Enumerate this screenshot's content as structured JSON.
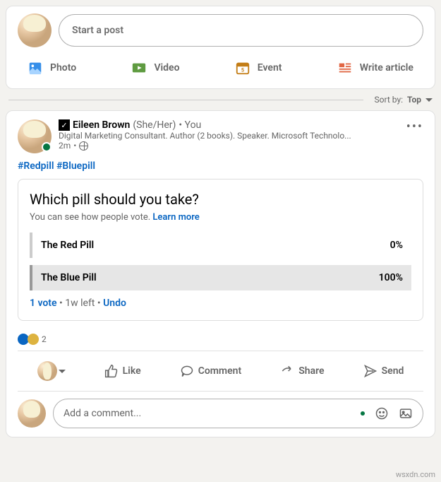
{
  "start_post": {
    "placeholder": "Start a post",
    "photo": "Photo",
    "video": "Video",
    "event": "Event",
    "article": "Write article"
  },
  "sort": {
    "label": "Sort by:",
    "value": "Top"
  },
  "post": {
    "name": "Eileen Brown",
    "pronoun": "(She/Her)",
    "you": "• You",
    "headline": "Digital Marketing Consultant. Author (2 books). Speaker. Microsoft Technolo...",
    "time": "2m",
    "hashtags": [
      "#Redpill",
      "#Bluepill"
    ]
  },
  "poll": {
    "question": "Which pill should you take?",
    "subtext": "You can see how people vote.",
    "learn": "Learn more",
    "options": [
      {
        "label": "The Red Pill",
        "pct": "0%"
      },
      {
        "label": "The Blue Pill",
        "pct": "100%"
      }
    ],
    "votes": "1 vote",
    "left": "1w left",
    "undo": "Undo"
  },
  "reactions": {
    "count": "2"
  },
  "action_bar": {
    "like": "Like",
    "comment": "Comment",
    "share": "Share",
    "send": "Send"
  },
  "comment": {
    "placeholder": "Add a comment..."
  },
  "watermark": "wsxdn.com"
}
